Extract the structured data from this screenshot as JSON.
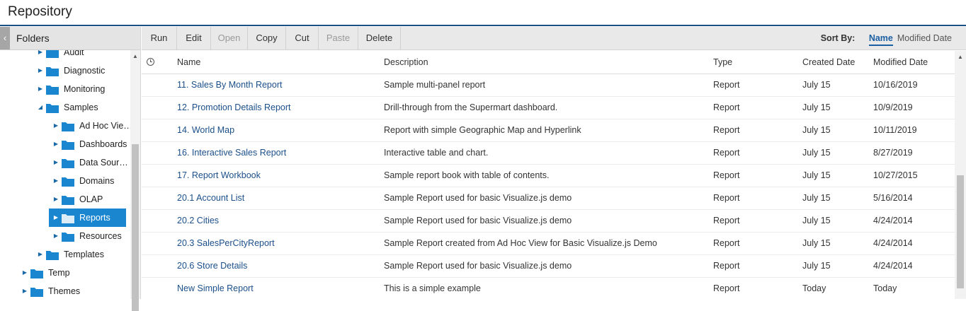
{
  "title": "Repository",
  "folders_panel": {
    "title": "Folders",
    "collapse_icon": "chevron-left-icon",
    "tree": [
      {
        "label": "Audit",
        "indent": 1,
        "state": "collapsed"
      },
      {
        "label": "Diagnostic",
        "indent": 1,
        "state": "collapsed"
      },
      {
        "label": "Monitoring",
        "indent": 1,
        "state": "collapsed"
      },
      {
        "label": "Samples",
        "indent": 1,
        "state": "expanded"
      },
      {
        "label": "Ad Hoc Vie…",
        "indent": 2,
        "state": "collapsed"
      },
      {
        "label": "Dashboards",
        "indent": 2,
        "state": "collapsed"
      },
      {
        "label": "Data Sour…",
        "indent": 2,
        "state": "collapsed"
      },
      {
        "label": "Domains",
        "indent": 2,
        "state": "collapsed"
      },
      {
        "label": "OLAP",
        "indent": 2,
        "state": "collapsed"
      },
      {
        "label": "Reports",
        "indent": 2,
        "state": "collapsed",
        "selected": true
      },
      {
        "label": "Resources",
        "indent": 2,
        "state": "collapsed"
      },
      {
        "label": "Templates",
        "indent": 1,
        "state": "collapsed"
      },
      {
        "label": "Temp",
        "indent": 0,
        "state": "collapsed"
      },
      {
        "label": "Themes",
        "indent": 0,
        "state": "collapsed"
      }
    ]
  },
  "toolbar": {
    "buttons": [
      {
        "label": "Run",
        "enabled": true
      },
      {
        "label": "Edit",
        "enabled": true
      },
      {
        "label": "Open",
        "enabled": false
      },
      {
        "label": "Copy",
        "enabled": true
      },
      {
        "label": "Cut",
        "enabled": true
      },
      {
        "label": "Paste",
        "enabled": false
      },
      {
        "label": "Delete",
        "enabled": true
      }
    ],
    "sort_by_label": "Sort By:",
    "sort_options": [
      {
        "label": "Name",
        "active": true
      },
      {
        "label": "Modified Date",
        "active": false
      }
    ]
  },
  "table": {
    "columns": {
      "name": "Name",
      "description": "Description",
      "type": "Type",
      "created": "Created Date",
      "modified": "Modified Date"
    },
    "rows": [
      {
        "name": "11. Sales By Month Report",
        "description": "Sample multi-panel report",
        "type": "Report",
        "created": "July 15",
        "modified": "10/16/2019"
      },
      {
        "name": "12. Promotion Details Report",
        "description": "Drill-through from the Supermart dashboard.",
        "type": "Report",
        "created": "July 15",
        "modified": "10/9/2019"
      },
      {
        "name": "14. World Map",
        "description": "Report with simple Geographic Map and Hyperlink",
        "type": "Report",
        "created": "July 15",
        "modified": "10/11/2019"
      },
      {
        "name": "16. Interactive Sales Report",
        "description": "Interactive table and chart.",
        "type": "Report",
        "created": "July 15",
        "modified": "8/27/2019"
      },
      {
        "name": "17. Report Workbook",
        "description": "Sample report book with table of contents.",
        "type": "Report",
        "created": "July 15",
        "modified": "10/27/2015"
      },
      {
        "name": "20.1 Account List",
        "description": "Sample Report used for basic Visualize.js demo",
        "type": "Report",
        "created": "July 15",
        "modified": "5/16/2014"
      },
      {
        "name": "20.2 Cities",
        "description": "Sample Report used for basic Visualize.js demo",
        "type": "Report",
        "created": "July 15",
        "modified": "4/24/2014"
      },
      {
        "name": "20.3 SalesPerCityReport",
        "description": "Sample Report created from Ad Hoc View for Basic Visualize.js Demo",
        "type": "Report",
        "created": "July 15",
        "modified": "4/24/2014"
      },
      {
        "name": "20.6 Store Details",
        "description": "Sample Report used for basic Visualize.js demo",
        "type": "Report",
        "created": "July 15",
        "modified": "4/24/2014"
      },
      {
        "name": "New Simple Report",
        "description": "This is a simple example",
        "type": "Report",
        "created": "Today",
        "modified": "Today"
      }
    ]
  },
  "colors": {
    "accent": "#1b4f8a",
    "selection": "#1a86d0",
    "folder": "#1a86d0"
  }
}
